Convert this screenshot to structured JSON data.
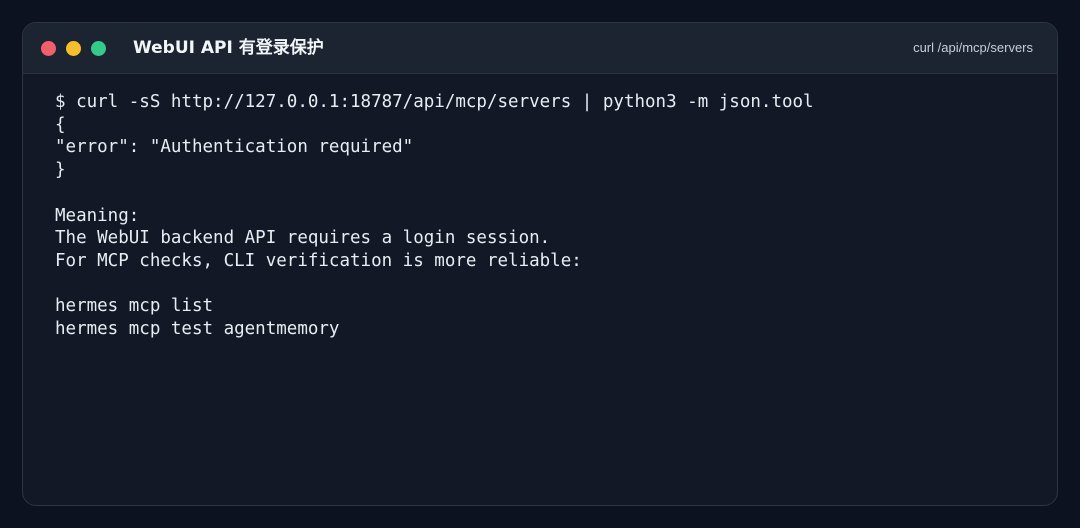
{
  "window": {
    "title": "WebUI API 有登录保护",
    "subtitle": "curl /api/mcp/servers",
    "controls": {
      "close_color": "#f25f6a",
      "minimize_color": "#f6be2c",
      "zoom_color": "#35c98a"
    }
  },
  "terminal": {
    "lines": [
      "$ curl -sS http://127.0.0.1:18787/api/mcp/servers | python3 -m json.tool",
      "{",
      "\"error\": \"Authentication required\"",
      "}",
      "",
      "Meaning:",
      "The WebUI backend API requires a login session.",
      "For MCP checks, CLI verification is more reliable:",
      "",
      "hermes mcp list",
      "hermes mcp test agentmemory"
    ]
  },
  "colors": {
    "page_background": "#0c1220",
    "window_background": "#121826",
    "titlebar_background": "#1c2431",
    "text": "#e8edf3"
  }
}
